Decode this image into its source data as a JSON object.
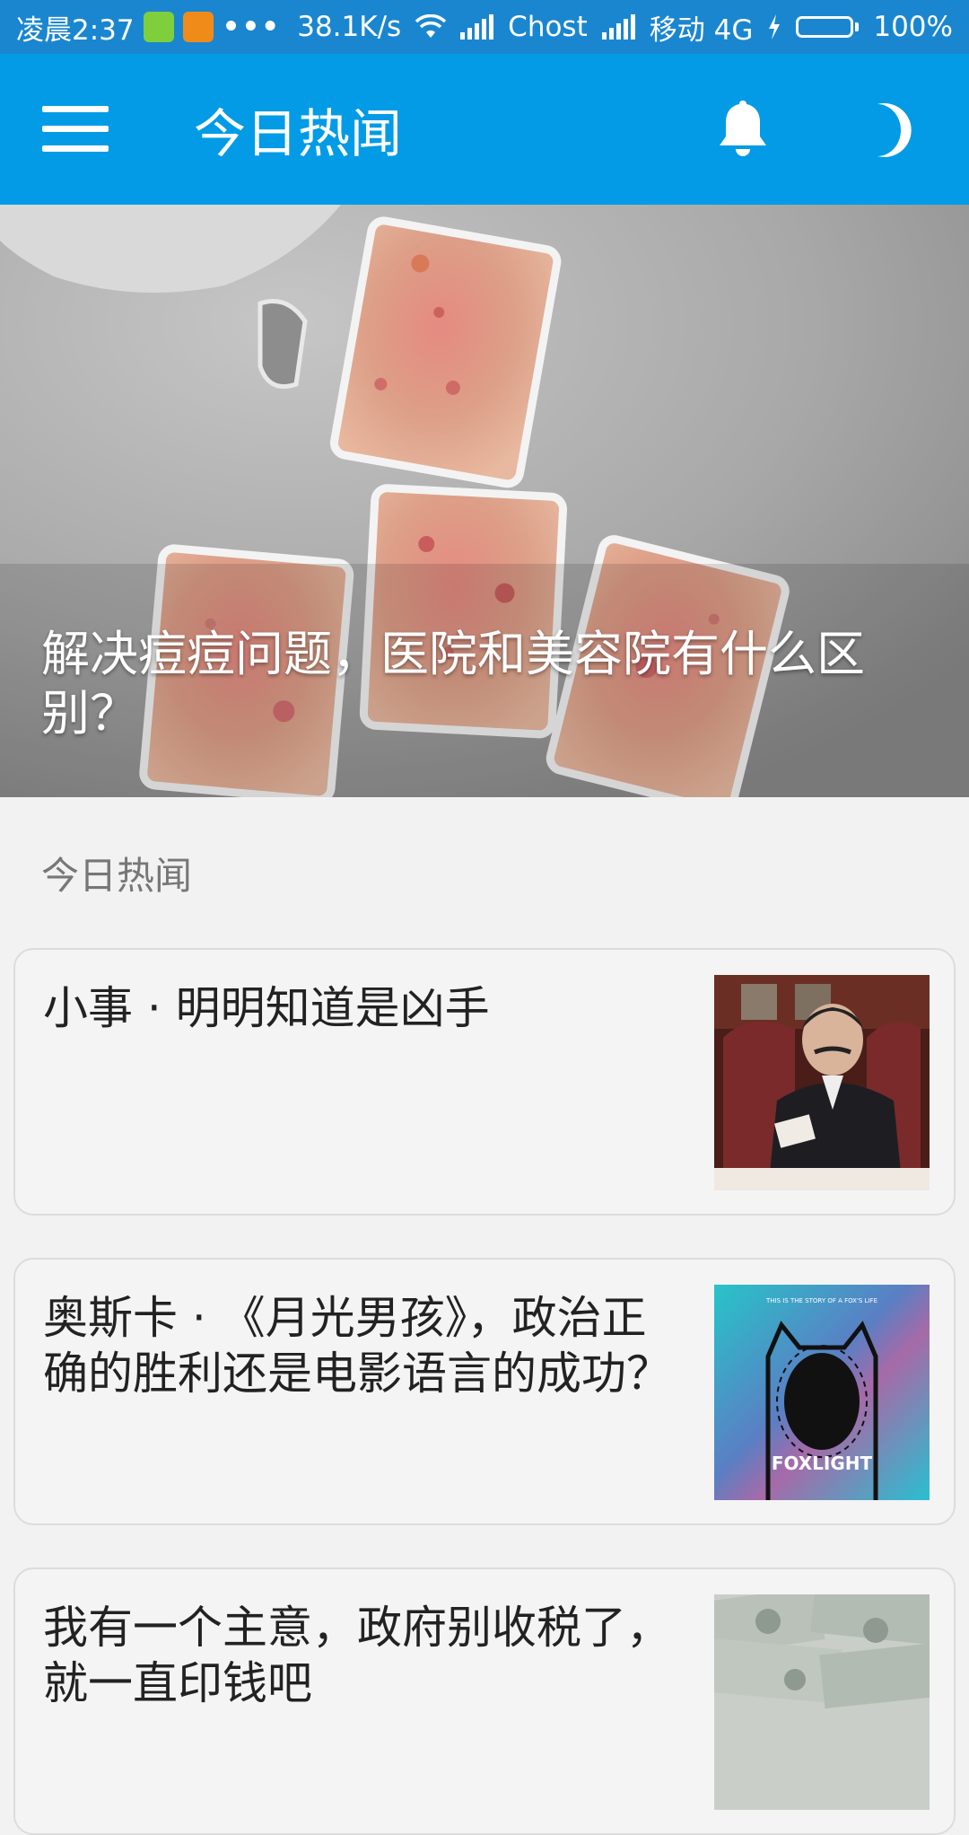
{
  "status_bar": {
    "time": "凌晨2:37",
    "more": "•••",
    "speed": "38.1K/s",
    "carrier1": "Chost",
    "carrier2": "移动 4G",
    "battery": "100%",
    "battery_level": 1.0
  },
  "app_bar": {
    "title": "今日热闻",
    "icons": [
      "menu-icon",
      "bell-icon",
      "moon-icon"
    ]
  },
  "hero": {
    "title": "解决痘痘问题，医院和美容院有什么区别？"
  },
  "section": {
    "header": "今日热闻"
  },
  "stories": [
    {
      "title": "小事 · 明明知道是凶手",
      "thumb": "man-in-armchair"
    },
    {
      "title": "奥斯卡 · 《月光男孩》，政治正确的胜利还是电影语言的成功？",
      "thumb": "foxlight-poster",
      "thumb_text": "FOXLIGHT",
      "thumb_small_text": "THIS IS THE STORY OF A FOX'S LIFE"
    },
    {
      "title": "我有一个主意，政府别收税了，就一直印钱吧",
      "thumb": "banknotes"
    }
  ],
  "colors": {
    "status_bar": "#1a86d0",
    "app_bar": "#039be5",
    "background": "#f2f2f2",
    "battery_fill": "#5cd432"
  }
}
